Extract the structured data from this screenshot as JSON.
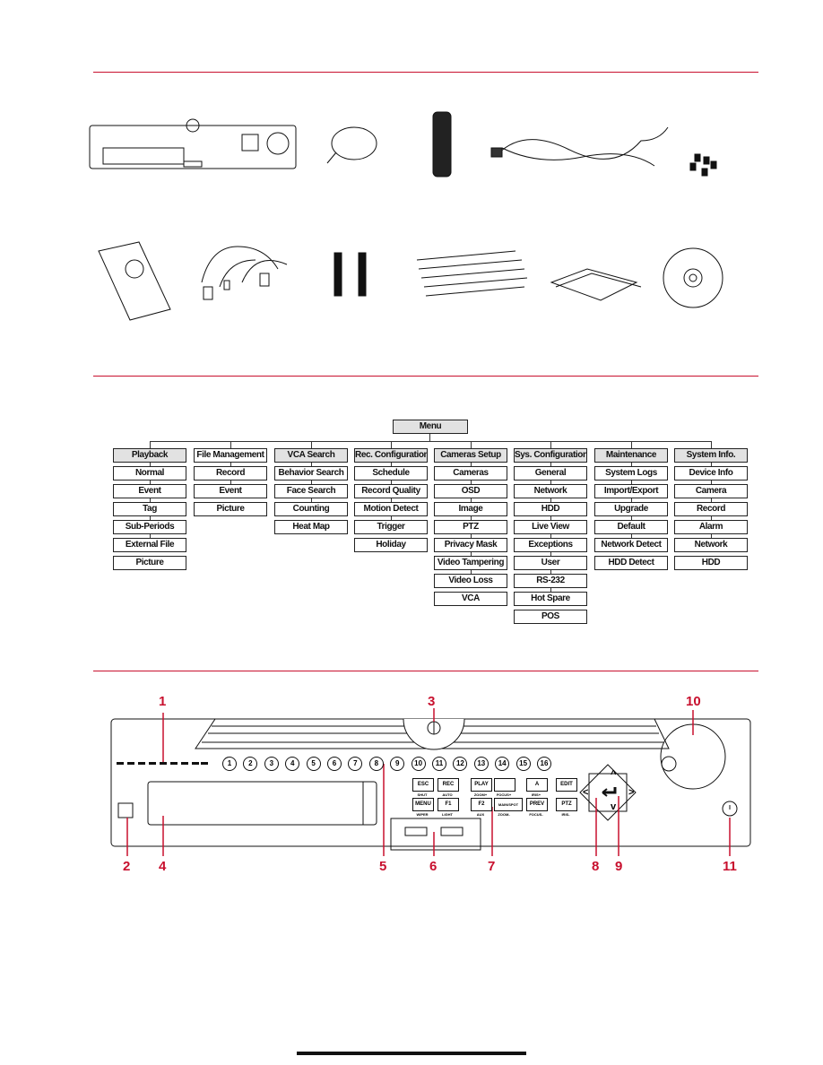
{
  "accessories": [
    "dvr-unit",
    "mouse",
    "remote-control",
    "power-cord",
    "screws",
    "hard-disk",
    "cable",
    "brackets",
    "cable-ties",
    "manual",
    "cd"
  ],
  "menu": {
    "root": "Menu",
    "columns": [
      {
        "title": "Playback",
        "items": [
          "Normal",
          "Event",
          "Tag",
          "Sub-Periods",
          "External File",
          "Picture"
        ]
      },
      {
        "title": "File Management",
        "items": [
          "Record",
          "Event",
          "Picture"
        ]
      },
      {
        "title": "VCA Search",
        "items": [
          "Behavior Search",
          "Face Search",
          "Counting",
          "Heat Map"
        ]
      },
      {
        "title": "Rec. Configuration",
        "items": [
          "Schedule",
          "Record Quality",
          "Motion Detect",
          "Trigger",
          "Holiday"
        ]
      },
      {
        "title": "Cameras Setup",
        "items": [
          "Cameras",
          "OSD",
          "Image",
          "PTZ",
          "Privacy Mask",
          "Video Tampering",
          "Video Loss",
          "VCA"
        ]
      },
      {
        "title": "Sys. Configuration",
        "items": [
          "General",
          "Network",
          "HDD",
          "Live View",
          "Exceptions",
          "User",
          "RS-232",
          "Hot Spare",
          "POS"
        ]
      },
      {
        "title": "Maintenance",
        "items": [
          "System Logs",
          "Import/Export",
          "Upgrade",
          "Default",
          "Network Detect",
          "HDD Detect"
        ]
      },
      {
        "title": "System Info.",
        "items": [
          "Device Info",
          "Camera",
          "Record",
          "Alarm",
          "Network",
          "HDD"
        ]
      }
    ]
  },
  "panel": {
    "callouts": [
      "1",
      "2",
      "3",
      "4",
      "5",
      "6",
      "7",
      "8",
      "9",
      "10",
      "11"
    ],
    "channels": [
      "1",
      "2",
      "3",
      "4",
      "5",
      "6",
      "7",
      "8",
      "9",
      "10",
      "11",
      "12",
      "13",
      "14",
      "15",
      "16"
    ],
    "buttons_row1": [
      "ESC",
      "REC",
      "PLAY",
      "",
      "A",
      "EDIT"
    ],
    "sub_row1": [
      "SHUT",
      "AUTO",
      "ZOOM+",
      "FOCUS+",
      "IRIS+",
      ""
    ],
    "buttons_row2": [
      "MENU",
      "F1",
      "F2",
      "MAIN/SPOT",
      "PREV",
      "PTZ"
    ],
    "sub_row2": [
      "WIPER",
      "LIGHT",
      "AUX",
      "ZOOM-",
      "FOCUS-",
      "IRIS-"
    ],
    "accent": "#c8102e"
  }
}
